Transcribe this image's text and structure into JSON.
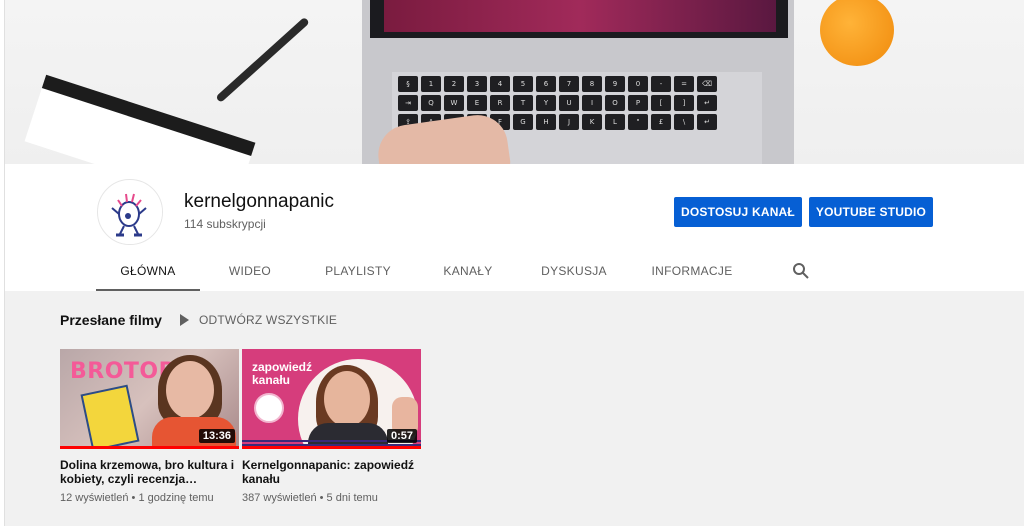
{
  "channel": {
    "name": "kernelgonnapanic",
    "subscribers": "114 subskrypcji"
  },
  "buttons": {
    "customize": "DOSTOSUJ KANAŁ",
    "studio": "YOUTUBE STUDIO"
  },
  "tabs": [
    {
      "label": "GŁÓWNA"
    },
    {
      "label": "WIDEO"
    },
    {
      "label": "PLAYLISTY"
    },
    {
      "label": "KANAŁY"
    },
    {
      "label": "DYSKUSJA"
    },
    {
      "label": "INFORMACJE"
    }
  ],
  "uploads": {
    "title": "Przesłane filmy",
    "play_all": "ODTWÓRZ WSZYSTKIE"
  },
  "videos": [
    {
      "thumb_text": "BROTOPIA",
      "duration": "13:36",
      "title": "Dolina krzemowa, bro kultura i kobiety, czyli recenzja…",
      "meta": "12 wyświetleń • 1 godzinę temu",
      "watched_fraction": 1.0
    },
    {
      "thumb_text": "zapowiedź kanału",
      "duration": "0:57",
      "title": "Kernelgonnapanic: zapowiedź kanału",
      "meta": "387 wyświetleń • 5 dni temu",
      "watched_fraction": 1.0
    }
  ],
  "keyboard_rows": [
    [
      "§",
      "1",
      "2",
      "3",
      "4",
      "5",
      "6",
      "7",
      "8",
      "9",
      "0",
      "-",
      "=",
      "⌫"
    ],
    [
      "⇥",
      "Q",
      "W",
      "E",
      "R",
      "T",
      "Y",
      "U",
      "I",
      "O",
      "P",
      "[",
      "]",
      "↵"
    ],
    [
      "⇪",
      "A",
      "S",
      "D",
      "F",
      "G",
      "H",
      "J",
      "K",
      "L",
      "\"",
      "£",
      "\\",
      "↵"
    ]
  ],
  "colors": {
    "primary_button": "#065fd4",
    "progress": "#ff0000"
  }
}
